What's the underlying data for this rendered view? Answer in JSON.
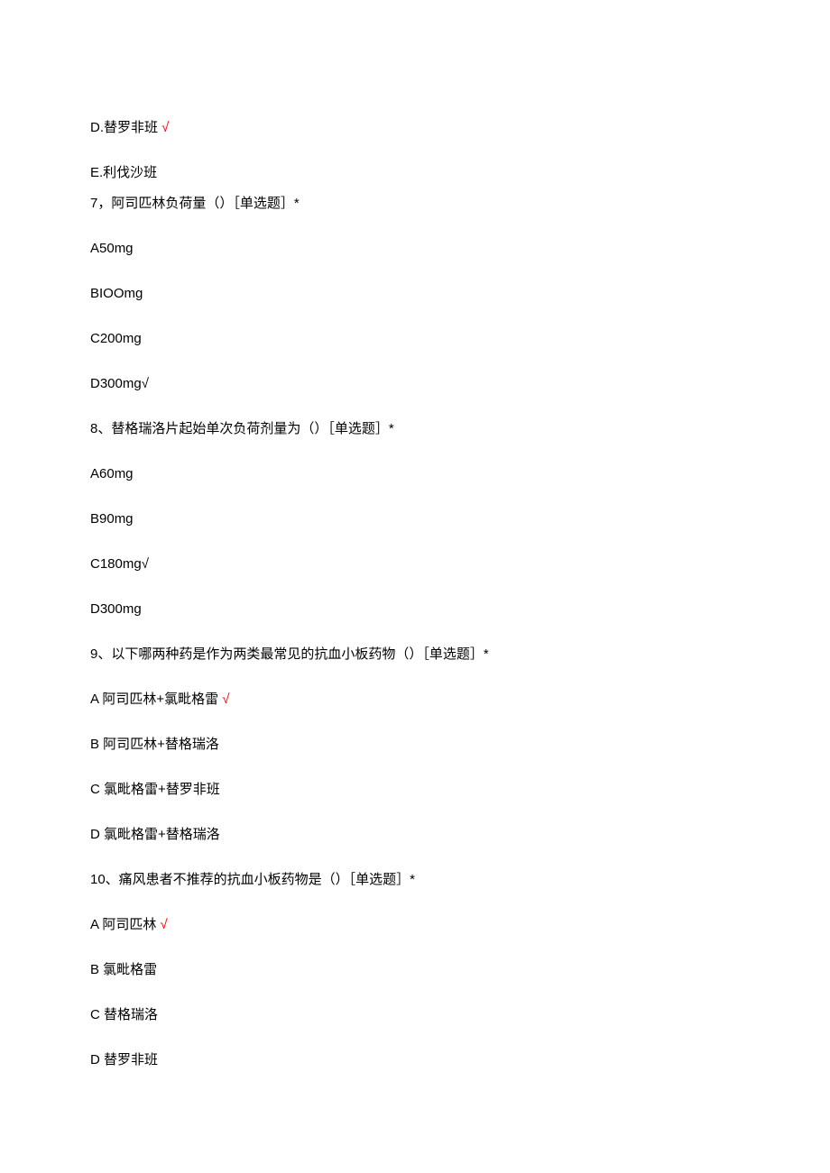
{
  "options_head": [
    {
      "label": "D.替罗非班 ",
      "mark": "√"
    },
    {
      "label": "E.利伐沙班",
      "mark": ""
    }
  ],
  "questions": [
    {
      "title": "7，阿司匹林负荷量（）［单选题］*",
      "options": [
        {
          "label": "A50mg",
          "mark": ""
        },
        {
          "label": "BIOOmg",
          "mark": ""
        },
        {
          "label": "C200mg",
          "mark": ""
        },
        {
          "label": "D300mg",
          "mark": "√",
          "inline": true
        }
      ]
    },
    {
      "title": "8、替格瑞洛片起始单次负荷剂量为（）［单选题］*",
      "options": [
        {
          "label": "A60mg",
          "mark": ""
        },
        {
          "label": "B90mg",
          "mark": ""
        },
        {
          "label": "C180mg",
          "mark": "√",
          "inline": true
        },
        {
          "label": "D300mg",
          "mark": ""
        }
      ]
    },
    {
      "title": "9、以下哪两种药是作为两类最常见的抗血小板药物（）［单选题］*",
      "options": [
        {
          "label": "A 阿司匹林+氯毗格雷 ",
          "mark": "√"
        },
        {
          "label": "B 阿司匹林+替格瑞洛",
          "mark": ""
        },
        {
          "label": "C 氯毗格雷+替罗非班",
          "mark": ""
        },
        {
          "label": "D 氯毗格雷+替格瑞洛",
          "mark": ""
        }
      ]
    },
    {
      "title": "10、痛风患者不推荐的抗血小板药物是（）［单选题］*",
      "options": [
        {
          "label": "A 阿司匹林 ",
          "mark": "√"
        },
        {
          "label": "B 氯毗格雷",
          "mark": ""
        },
        {
          "label": "C 替格瑞洛",
          "mark": ""
        },
        {
          "label": "D 替罗非班",
          "mark": ""
        }
      ]
    }
  ]
}
